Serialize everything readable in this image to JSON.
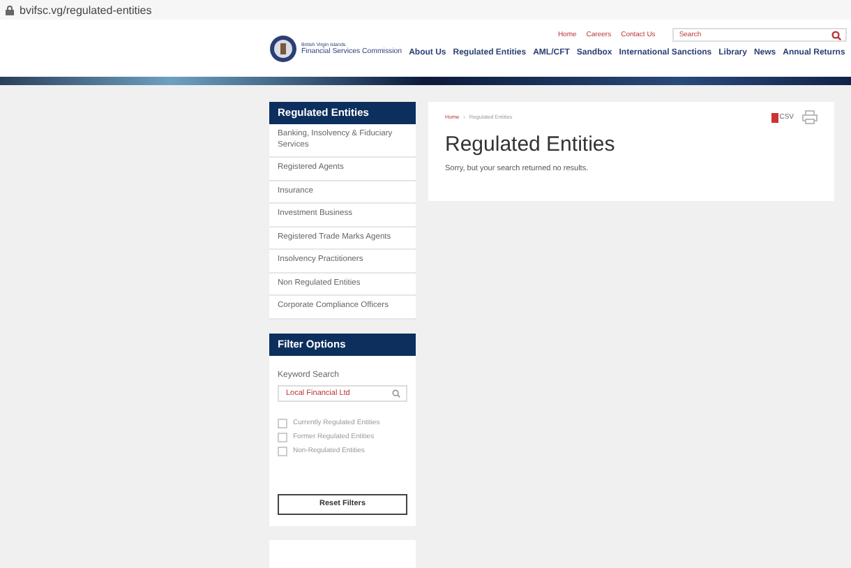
{
  "address_bar": {
    "url": "bvifsc.vg/regulated-entities"
  },
  "header": {
    "logo_small": "British Virgin Islands",
    "logo_title": "Financial Services Commission",
    "utility_links": [
      "Home",
      "Careers",
      "Contact Us"
    ],
    "search": {
      "placeholder": "Search"
    },
    "nav": [
      "About Us",
      "Regulated Entities",
      "AML/CFT",
      "Sandbox",
      "International Sanctions",
      "Library",
      "News",
      "Annual Returns"
    ]
  },
  "sidebar": {
    "title": "Regulated Entities",
    "items": [
      "Banking, Insolvency & Fiduciary Services",
      "Registered Agents",
      "Insurance",
      "Investment Business",
      "Registered Trade Marks Agents",
      "Insolvency Practitioners",
      "Non Regulated Entities",
      "Corporate Compliance Officers"
    ]
  },
  "filter": {
    "title": "Filter Options",
    "keyword_label": "Keyword Search",
    "keyword_value": "Local Financial Ltd",
    "options": [
      {
        "label": "Currently Regulated Entities",
        "checked": false
      },
      {
        "label": "Former Regulated Entities",
        "checked": false
      },
      {
        "label": "Non-Regulated Entities",
        "checked": false
      }
    ],
    "reset": "Reset Filters"
  },
  "main": {
    "breadcrumb": [
      "Home",
      "Regulated Entities"
    ],
    "breadcrumb_separator": "›",
    "csv": "CSV",
    "title": "Regulated Entities",
    "message": "Sorry, but your search returned no results."
  }
}
